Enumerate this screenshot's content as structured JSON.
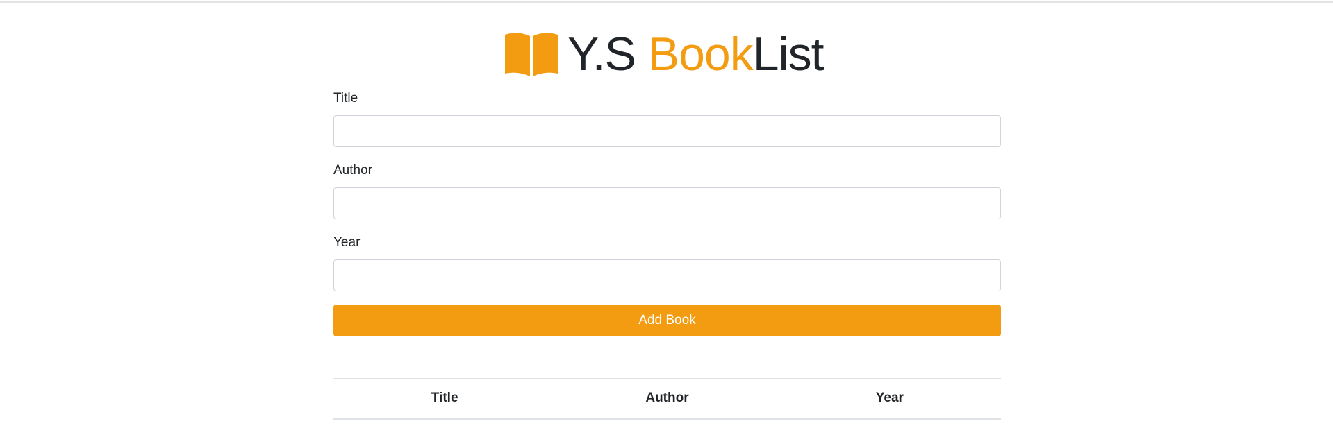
{
  "brand": {
    "prefix": "Y.S ",
    "highlight": "Book",
    "suffix": "List",
    "icon": "open-book-icon",
    "accent_color": "#f39c12"
  },
  "form": {
    "title_label": "Title",
    "title_value": "",
    "author_label": "Author",
    "author_value": "",
    "year_label": "Year",
    "year_value": "",
    "submit_label": "Add Book"
  },
  "table": {
    "columns": [
      "Title",
      "Author",
      "Year"
    ],
    "rows": []
  }
}
